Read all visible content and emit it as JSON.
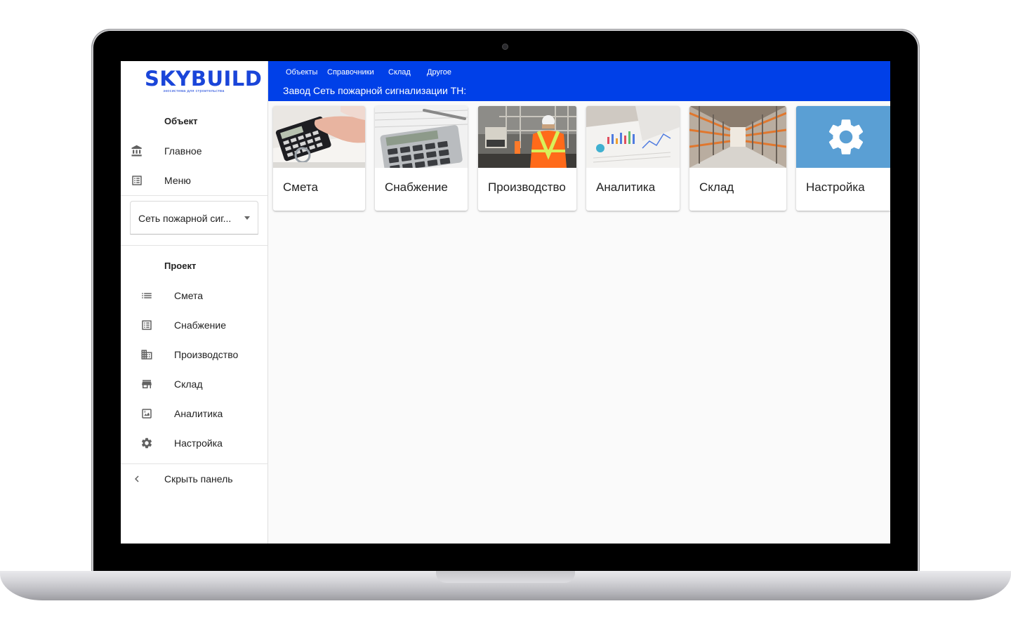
{
  "brand": {
    "name": "SKYBUILD",
    "tagline": "экосистема для строительства"
  },
  "sidebar": {
    "object_title": "Объект",
    "object_items": [
      {
        "label": "Главное",
        "icon": "bank-icon"
      },
      {
        "label": "Меню",
        "icon": "list-alt-icon"
      }
    ],
    "object_select": {
      "value": "Сеть пожарной сиг..."
    },
    "project_title": "Проект",
    "project_items": [
      {
        "label": "Смета",
        "icon": "list-icon"
      },
      {
        "label": "Снабжение",
        "icon": "list-alt-icon"
      },
      {
        "label": "Производство",
        "icon": "building-icon"
      },
      {
        "label": "Склад",
        "icon": "store-icon"
      },
      {
        "label": "Аналитика",
        "icon": "analytics-icon"
      },
      {
        "label": "Настройка",
        "icon": "gear-icon"
      }
    ],
    "hide_panel": {
      "label": "Скрыть панель",
      "icon": "chevron-left-icon"
    }
  },
  "topbar": {
    "menu": [
      "Объекты",
      "Справочники",
      "Склад",
      "Другое"
    ],
    "subtitle": "Завод Сеть пожарной сигнализации ТН:",
    "color": "#0040e8"
  },
  "tiles": [
    {
      "label": "Смета",
      "image": "calculator-hand-photo"
    },
    {
      "label": "Снабжение",
      "image": "calculator-photo"
    },
    {
      "label": "Производство",
      "image": "construction-worker-photo"
    },
    {
      "label": "Аналитика",
      "image": "charts-documents-photo"
    },
    {
      "label": "Склад",
      "image": "warehouse-photo"
    },
    {
      "label": "Настройка",
      "image": "gear-icon",
      "image_bg": "#5a9fd4"
    }
  ]
}
